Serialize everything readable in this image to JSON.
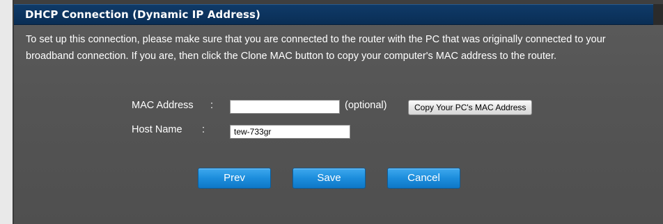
{
  "panel": {
    "title": "DHCP Connection (Dynamic IP Address)",
    "description": "To set up this connection, please make sure that you are connected to the router with the PC that was originally connected to your broadband connection. If you are, then click the Clone MAC button to copy your computer's MAC address to the router."
  },
  "form": {
    "mac_address": {
      "label": "MAC Address",
      "separator": ":",
      "value": "",
      "hint": "(optional)",
      "clone_button_label": "Copy Your PC's MAC Address"
    },
    "host_name": {
      "label": "Host Name",
      "separator": ":",
      "value": "tew-733gr"
    }
  },
  "actions": {
    "prev_label": "Prev",
    "save_label": "Save",
    "cancel_label": "Cancel"
  },
  "colors": {
    "header_bg": "#0f3a68",
    "panel_bg": "#555555",
    "button_blue": "#1c8ddc"
  }
}
